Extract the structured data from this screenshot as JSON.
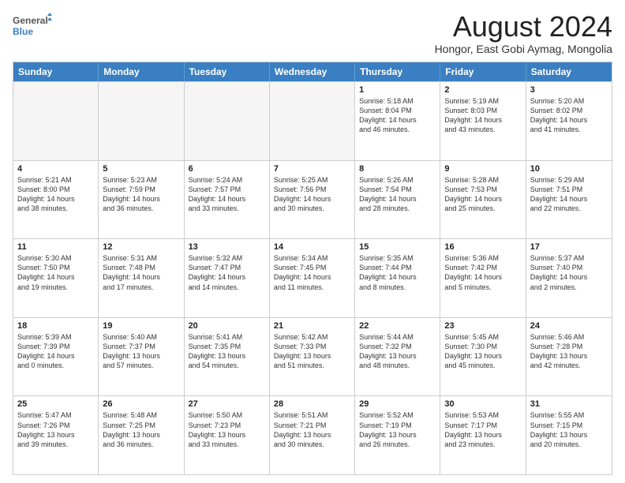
{
  "header": {
    "logo_line1": "General",
    "logo_line2": "Blue",
    "month": "August 2024",
    "location": "Hongor, East Gobi Aymag, Mongolia"
  },
  "days": [
    "Sunday",
    "Monday",
    "Tuesday",
    "Wednesday",
    "Thursday",
    "Friday",
    "Saturday"
  ],
  "rows": [
    [
      {
        "day": "",
        "empty": true
      },
      {
        "day": "",
        "empty": true
      },
      {
        "day": "",
        "empty": true
      },
      {
        "day": "",
        "empty": true
      },
      {
        "day": "1",
        "text": "Sunrise: 5:18 AM\nSunset: 8:04 PM\nDaylight: 14 hours\nand 46 minutes."
      },
      {
        "day": "2",
        "text": "Sunrise: 5:19 AM\nSunset: 8:03 PM\nDaylight: 14 hours\nand 43 minutes."
      },
      {
        "day": "3",
        "text": "Sunrise: 5:20 AM\nSunset: 8:02 PM\nDaylight: 14 hours\nand 41 minutes."
      }
    ],
    [
      {
        "day": "4",
        "text": "Sunrise: 5:21 AM\nSunset: 8:00 PM\nDaylight: 14 hours\nand 38 minutes."
      },
      {
        "day": "5",
        "text": "Sunrise: 5:23 AM\nSunset: 7:59 PM\nDaylight: 14 hours\nand 36 minutes."
      },
      {
        "day": "6",
        "text": "Sunrise: 5:24 AM\nSunset: 7:57 PM\nDaylight: 14 hours\nand 33 minutes."
      },
      {
        "day": "7",
        "text": "Sunrise: 5:25 AM\nSunset: 7:56 PM\nDaylight: 14 hours\nand 30 minutes."
      },
      {
        "day": "8",
        "text": "Sunrise: 5:26 AM\nSunset: 7:54 PM\nDaylight: 14 hours\nand 28 minutes."
      },
      {
        "day": "9",
        "text": "Sunrise: 5:28 AM\nSunset: 7:53 PM\nDaylight: 14 hours\nand 25 minutes."
      },
      {
        "day": "10",
        "text": "Sunrise: 5:29 AM\nSunset: 7:51 PM\nDaylight: 14 hours\nand 22 minutes."
      }
    ],
    [
      {
        "day": "11",
        "text": "Sunrise: 5:30 AM\nSunset: 7:50 PM\nDaylight: 14 hours\nand 19 minutes."
      },
      {
        "day": "12",
        "text": "Sunrise: 5:31 AM\nSunset: 7:48 PM\nDaylight: 14 hours\nand 17 minutes."
      },
      {
        "day": "13",
        "text": "Sunrise: 5:32 AM\nSunset: 7:47 PM\nDaylight: 14 hours\nand 14 minutes."
      },
      {
        "day": "14",
        "text": "Sunrise: 5:34 AM\nSunset: 7:45 PM\nDaylight: 14 hours\nand 11 minutes."
      },
      {
        "day": "15",
        "text": "Sunrise: 5:35 AM\nSunset: 7:44 PM\nDaylight: 14 hours\nand 8 minutes."
      },
      {
        "day": "16",
        "text": "Sunrise: 5:36 AM\nSunset: 7:42 PM\nDaylight: 14 hours\nand 5 minutes."
      },
      {
        "day": "17",
        "text": "Sunrise: 5:37 AM\nSunset: 7:40 PM\nDaylight: 14 hours\nand 2 minutes."
      }
    ],
    [
      {
        "day": "18",
        "text": "Sunrise: 5:39 AM\nSunset: 7:39 PM\nDaylight: 14 hours\nand 0 minutes."
      },
      {
        "day": "19",
        "text": "Sunrise: 5:40 AM\nSunset: 7:37 PM\nDaylight: 13 hours\nand 57 minutes."
      },
      {
        "day": "20",
        "text": "Sunrise: 5:41 AM\nSunset: 7:35 PM\nDaylight: 13 hours\nand 54 minutes."
      },
      {
        "day": "21",
        "text": "Sunrise: 5:42 AM\nSunset: 7:33 PM\nDaylight: 13 hours\nand 51 minutes."
      },
      {
        "day": "22",
        "text": "Sunrise: 5:44 AM\nSunset: 7:32 PM\nDaylight: 13 hours\nand 48 minutes."
      },
      {
        "day": "23",
        "text": "Sunrise: 5:45 AM\nSunset: 7:30 PM\nDaylight: 13 hours\nand 45 minutes."
      },
      {
        "day": "24",
        "text": "Sunrise: 5:46 AM\nSunset: 7:28 PM\nDaylight: 13 hours\nand 42 minutes."
      }
    ],
    [
      {
        "day": "25",
        "text": "Sunrise: 5:47 AM\nSunset: 7:26 PM\nDaylight: 13 hours\nand 39 minutes."
      },
      {
        "day": "26",
        "text": "Sunrise: 5:48 AM\nSunset: 7:25 PM\nDaylight: 13 hours\nand 36 minutes."
      },
      {
        "day": "27",
        "text": "Sunrise: 5:50 AM\nSunset: 7:23 PM\nDaylight: 13 hours\nand 33 minutes."
      },
      {
        "day": "28",
        "text": "Sunrise: 5:51 AM\nSunset: 7:21 PM\nDaylight: 13 hours\nand 30 minutes."
      },
      {
        "day": "29",
        "text": "Sunrise: 5:52 AM\nSunset: 7:19 PM\nDaylight: 13 hours\nand 26 minutes."
      },
      {
        "day": "30",
        "text": "Sunrise: 5:53 AM\nSunset: 7:17 PM\nDaylight: 13 hours\nand 23 minutes."
      },
      {
        "day": "31",
        "text": "Sunrise: 5:55 AM\nSunset: 7:15 PM\nDaylight: 13 hours\nand 20 minutes."
      }
    ]
  ]
}
